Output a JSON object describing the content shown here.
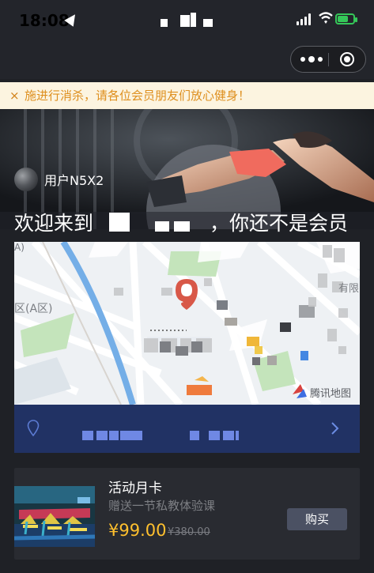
{
  "status_bar": {
    "time": "18:08",
    "battery_level": 0.7,
    "icons": [
      "location-arrow-icon",
      "signal-icon",
      "wifi-icon",
      "battery-charging-icon"
    ]
  },
  "nav": {
    "title": "",
    "more_icon": "more-dots-icon",
    "close_icon": "close-circle-icon"
  },
  "notice": {
    "close_icon": "close-icon",
    "close_label": "×",
    "text": "施进行消杀，请各位会员朋友们放心健身！"
  },
  "banner": {
    "user_name": "用户N5X2",
    "welcome_prefix": "欢迎来到",
    "welcome_suffix": "，你还不是会员"
  },
  "map": {
    "provider": "腾讯地图",
    "labels": {
      "left_edge": "区(A区)",
      "top_left": "A)",
      "right_edge": "有限"
    },
    "pin_icon": "map-pin-icon",
    "location_icon": "location-pin-icon",
    "chevron_icon": "chevron-right-icon",
    "address": ""
  },
  "product": {
    "name": "活动月卡",
    "description": "赠送一节私教体验课",
    "price": "¥99.00",
    "original_price": "¥380.00",
    "buy_label": "购买"
  },
  "colors": {
    "background": "#1f2126",
    "notice_bg": "#fcf4e0",
    "notice_text": "#de8f1e",
    "map_footer": "#213264",
    "price": "#ffc02e",
    "buy_button": "#4b5163"
  }
}
